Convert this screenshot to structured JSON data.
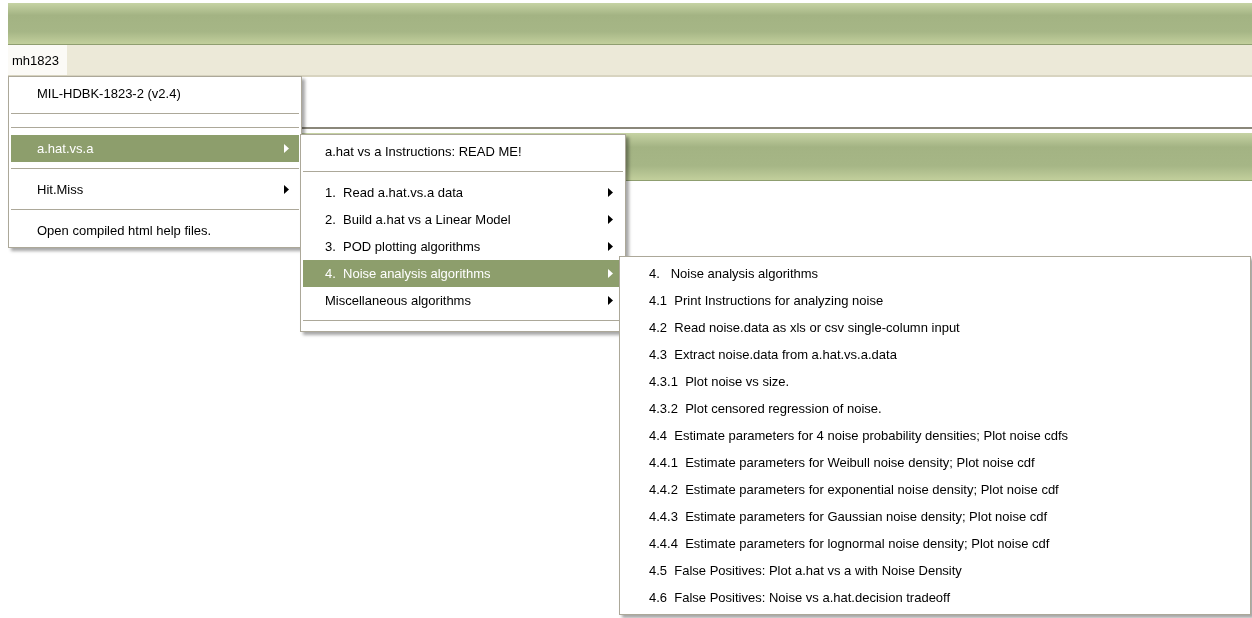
{
  "menu_bar": {
    "items": [
      {
        "label": "mh1823",
        "selected": true
      }
    ]
  },
  "menus": [
    {
      "items": [
        {
          "kind": "item",
          "label": "MIL-HDBK-1823-2 (v2.4)",
          "submenu": false,
          "selected": false
        },
        {
          "kind": "separator"
        },
        {
          "kind": "separator"
        },
        {
          "kind": "item",
          "label": "a.hat.vs.a",
          "submenu": true,
          "selected": true
        },
        {
          "kind": "separator"
        },
        {
          "kind": "item",
          "label": "Hit.Miss",
          "submenu": true,
          "selected": false
        },
        {
          "kind": "separator"
        },
        {
          "kind": "item",
          "label": "Open compiled html help files.",
          "submenu": false,
          "selected": false
        }
      ]
    },
    {
      "items": [
        {
          "kind": "item",
          "label": "a.hat vs a Instructions: READ ME!",
          "submenu": false,
          "selected": false
        },
        {
          "kind": "separator"
        },
        {
          "kind": "item",
          "label": "1.  Read a.hat.vs.a data",
          "submenu": true,
          "selected": false
        },
        {
          "kind": "item",
          "label": "2.  Build a.hat vs a Linear Model",
          "submenu": true,
          "selected": false
        },
        {
          "kind": "item",
          "label": "3.  POD plotting algorithms",
          "submenu": true,
          "selected": false
        },
        {
          "kind": "item",
          "label": "4.  Noise analysis algorithms",
          "submenu": true,
          "selected": true
        },
        {
          "kind": "item",
          "label": "Miscellaneous algorithms",
          "submenu": true,
          "selected": false
        },
        {
          "kind": "separator"
        }
      ]
    },
    {
      "items": [
        {
          "kind": "item",
          "label": "4.   Noise analysis algorithms",
          "submenu": false,
          "selected": false
        },
        {
          "kind": "item",
          "label": "4.1  Print Instructions for analyzing noise",
          "submenu": false,
          "selected": false
        },
        {
          "kind": "item",
          "label": "4.2  Read noise.data as xls or csv single-column input",
          "submenu": false,
          "selected": false
        },
        {
          "kind": "item",
          "label": "4.3  Extract noise.data from a.hat.vs.a.data",
          "submenu": false,
          "selected": false
        },
        {
          "kind": "item",
          "label": "4.3.1  Plot noise vs size.",
          "submenu": false,
          "selected": false
        },
        {
          "kind": "item",
          "label": "4.3.2  Plot censored regression of noise.",
          "submenu": false,
          "selected": false
        },
        {
          "kind": "item",
          "label": "4.4  Estimate parameters for 4 noise probability densities; Plot noise cdfs",
          "submenu": false,
          "selected": false
        },
        {
          "kind": "item",
          "label": "4.4.1  Estimate parameters for Weibull noise density; Plot noise cdf",
          "submenu": false,
          "selected": false
        },
        {
          "kind": "item",
          "label": "4.4.2  Estimate parameters for exponential noise density; Plot noise cdf",
          "submenu": false,
          "selected": false
        },
        {
          "kind": "item",
          "label": "4.4.3  Estimate parameters for Gaussian noise density; Plot noise cdf",
          "submenu": false,
          "selected": false
        },
        {
          "kind": "item",
          "label": "4.4.4  Estimate parameters for lognormal noise density; Plot noise cdf",
          "submenu": false,
          "selected": false
        },
        {
          "kind": "item",
          "label": "4.5  False Positives: Plot a.hat vs a with Noise Density",
          "submenu": false,
          "selected": false
        },
        {
          "kind": "item",
          "label": "4.6  False Positives: Noise vs a.hat.decision tradeoff",
          "submenu": false,
          "selected": false
        }
      ]
    }
  ]
}
